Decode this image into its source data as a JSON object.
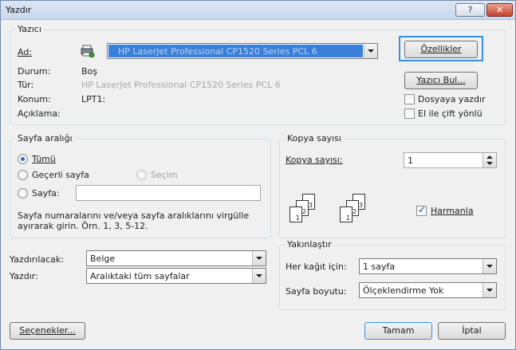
{
  "window": {
    "title": "Yazdır",
    "help_label": "?",
    "close_label": "✕"
  },
  "printer": {
    "group_label": "Yazıcı",
    "name_label": "Ad:",
    "name_value": "HP LaserJet Professional CP1520 Series PCL 6",
    "status_label": "Durum:",
    "status_value": "Boş",
    "type_label": "Tür:",
    "type_value": "HP LaserJet Professional CP1520 Series PCL 6",
    "location_label": "Konum:",
    "location_value": "LPT1:",
    "comment_label": "Açıklama:",
    "properties_button": "Özellikler",
    "find_button": "Yazıcı Bul...",
    "print_to_file_label": "Dosyaya yazdır",
    "print_to_file_checked": false,
    "manual_duplex_label": "El ile çift yönlü",
    "manual_duplex_checked": false
  },
  "page_range": {
    "group_label": "Sayfa aralığı",
    "all_label": "Tümü",
    "current_label": "Geçerli sayfa",
    "selection_label": "Seçim",
    "pages_label": "Sayfa:",
    "pages_value": "",
    "hint_line1": "Sayfa numaralarını ve/veya sayfa aralıklarını virgülle",
    "hint_line2": "ayırarak girin. Örn. 1, 3, 5-12.",
    "selected": "all"
  },
  "copies": {
    "group_label": "Kopya sayısı",
    "count_label": "Kopya sayısı:",
    "count_value": "1",
    "collate_label": "Harmanla",
    "collate_checked": true,
    "page_numbers": [
      "1",
      "2",
      "3"
    ]
  },
  "print_what": {
    "label": "Yazdırılacak:",
    "value": "Belge"
  },
  "print": {
    "label": "Yazdır:",
    "value": "Aralıktaki tüm sayfalar"
  },
  "zoom": {
    "group_label": "Yakınlaştır",
    "pages_per_sheet_label": "Her kağıt için:",
    "pages_per_sheet_value": "1 sayfa",
    "scale_label": "Sayfa boyutu:",
    "scale_value": "Ölçeklendirme Yok"
  },
  "footer": {
    "options_button": "Seçenekler...",
    "ok_button": "Tamam",
    "cancel_button": "İptal"
  },
  "colors": {
    "focus_ring": "#3c8fd6",
    "printer_highlight": "#3a7fd8"
  }
}
